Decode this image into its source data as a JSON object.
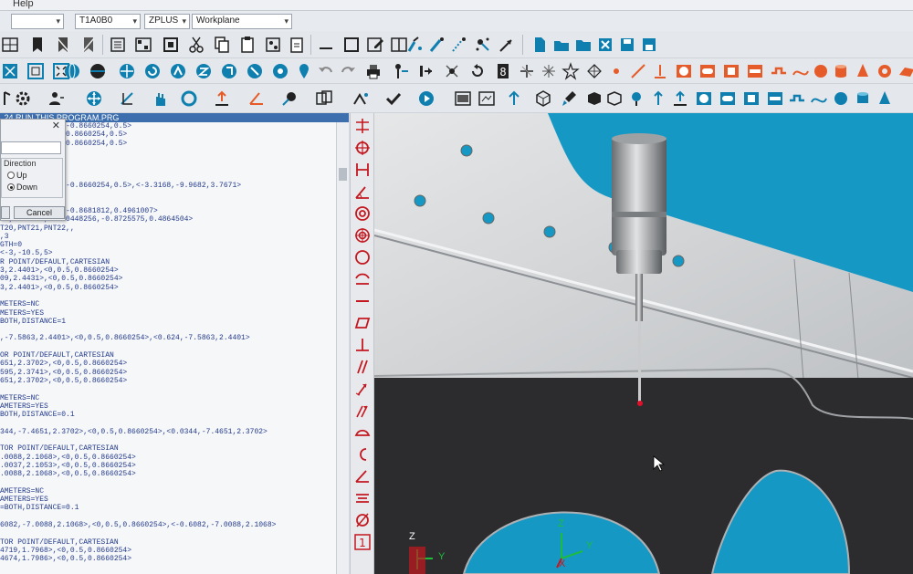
{
  "menu": {
    "help": "Help"
  },
  "combos": {
    "probe": "T1A0B0",
    "plane": "ZPLUS",
    "workplane": "Workplane"
  },
  "editor": {
    "title": ".24 RUN THIS PROGRAM.PRG",
    "lines": [
      "              ,-0.8660254,0.5>",
      "              ,0.8660254,0.5>",
      "              ,0.8660254,0.5>",
      "",
      "",
      "         3937",
      "",
      "        71>,<0,-0.8660254,0.5>,<-3.3168,-9.9682,3.7671>",
      "",
      "",
      "       0120583,-0.8681812,0.4961007>",
      "38,4.3015>,<-0.0448256,-0.8725575,0.4864504>",
      "T20,PNT21,PNT22,,",
      ",3",
      "GTH=0",
      "<-3,-10.5,5>",
      "R POINT/DEFAULT,CARTESIAN",
      "3,2.4401>,<0,0.5,0.8660254>",
      "09,2.4431>,<0,0.5,0.8660254>",
      "3,2.4401>,<0,0.5,0.8660254>",
      "",
      "METERS=NC",
      "METERS=YES",
      "BOTH,DISTANCE=1",
      "",
      ",-7.5863,2.4401>,<0,0.5,0.8660254>,<0.624,-7.5863,2.4401>",
      "",
      "OR POINT/DEFAULT,CARTESIAN",
      "651,2.3702>,<0,0.5,0.8660254>",
      "595,2.3741>,<0,0.5,0.8660254>",
      "651,2.3702>,<0,0.5,0.8660254>",
      "",
      "METERS=NC",
      "AMETERS=YES",
      "BOTH,DISTANCE=0.1",
      "",
      "344,-7.4651,2.3702>,<0,0.5,0.8660254>,<0.0344,-7.4651,2.3702>",
      "",
      "TOR POINT/DEFAULT,CARTESIAN",
      ".0088,2.1068>,<0,0.5,0.8660254>",
      ".0037,2.1053>,<0,0.5,0.8660254>",
      ".0088,2.1068>,<0,0.5,0.8660254>",
      "",
      "AMETERS=NC",
      "AMETERS=YES",
      "=BOTH,DISTANCE=0.1",
      "",
      "6082,-7.0088,2.1068>,<0,0.5,0.8660254>,<-0.6082,-7.0088,2.1068>",
      "",
      "TOR POINT/DEFAULT,CARTESIAN",
      "4719,1.7968>,<0,0.5,0.8660254>",
      "4674,1.7986>,<0,0.5,0.8660254>"
    ]
  },
  "dialog": {
    "group_label": "Direction",
    "radio_up": "Up",
    "radio_down": "Down",
    "selected": "Down",
    "cancel_label": "Cancel"
  },
  "view": {
    "axis_z": "Z",
    "axis_y": "Y",
    "axis_x": "X",
    "colors": {
      "background": "#1598c4",
      "part_light": "#d6d8da",
      "part_dark": "#2c2b2d",
      "probe_tip": "#e0102a"
    }
  },
  "vtoolbar": {
    "last_button_label": "1"
  }
}
